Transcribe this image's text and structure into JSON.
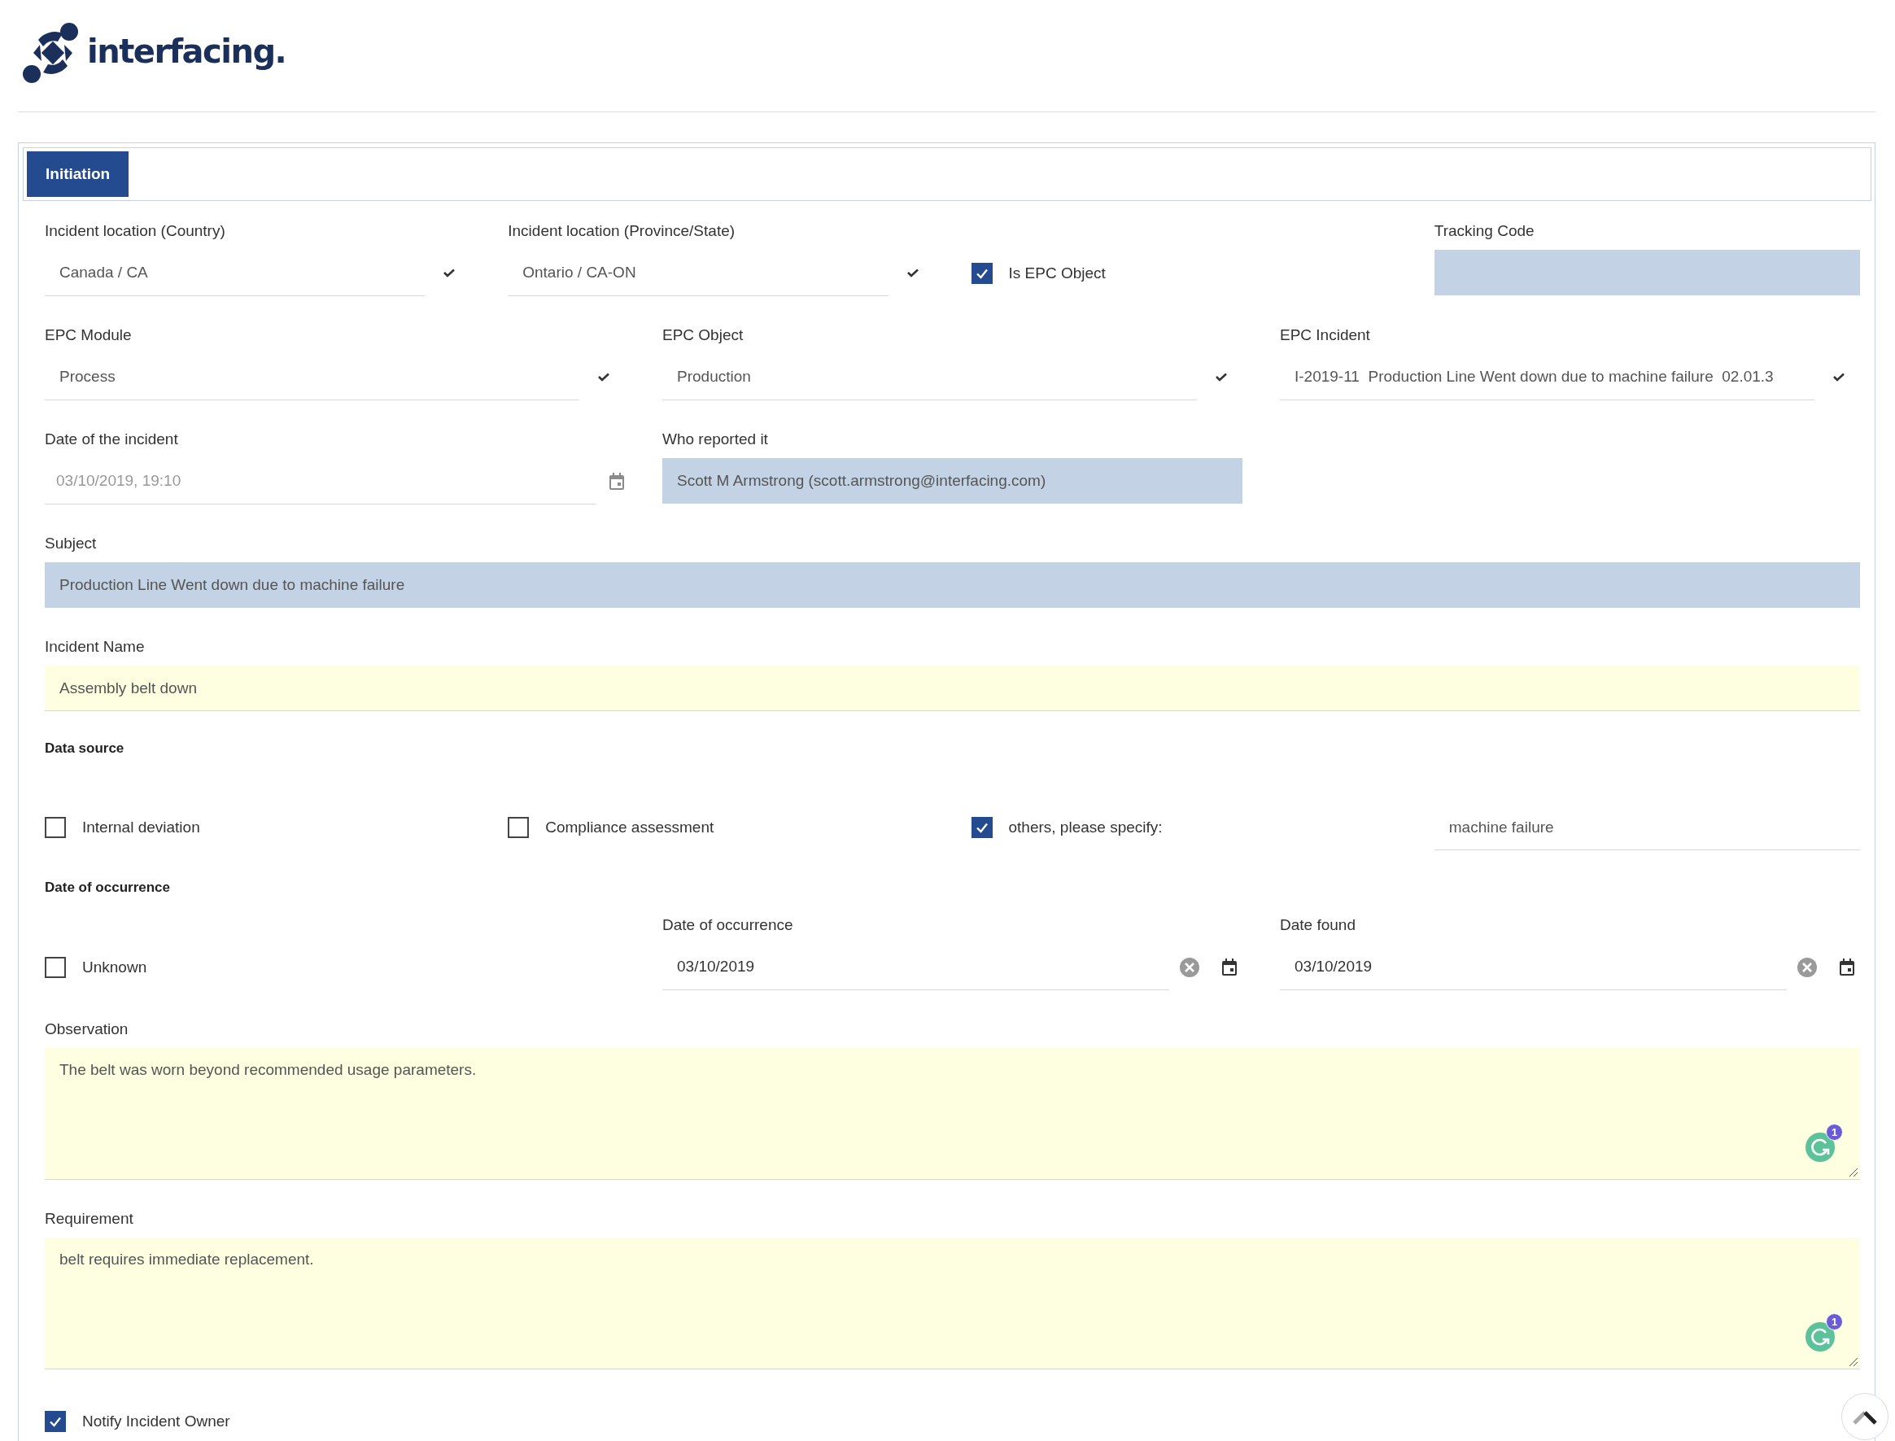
{
  "logo": {
    "text": "interfacing."
  },
  "tabs": [
    {
      "label": "Initiation",
      "selected": true
    }
  ],
  "rows": [
    {
      "fields": [
        {
          "kind": "select",
          "label": "Incident location (Country)",
          "value": "Canada / CA"
        },
        {
          "kind": "select",
          "label": "Incident location (Province/State)",
          "value": "Ontario / CA-ON"
        },
        {
          "kind": "checkbox",
          "label": "Is EPC Object",
          "checked": true
        },
        {
          "kind": "readonly",
          "label": "Tracking Code"
        }
      ]
    },
    {
      "fields": [
        {
          "kind": "select",
          "label": "EPC Module",
          "value": "Process"
        },
        {
          "kind": "select",
          "label": "EPC Object",
          "value": "Production"
        },
        {
          "kind": "select",
          "label": "EPC Incident",
          "value": "I-2019-11  Production Line Went down due to machine failure  02.01.3"
        }
      ]
    },
    {
      "fields": [
        {
          "kind": "datetime",
          "label": "Date of the incident",
          "value": "03/10/2019, 19:10",
          "disabled": true
        },
        {
          "kind": "readonly",
          "label": "Who reported it",
          "value": "Scott M Armstrong (scott.armstrong@interfacing.com)"
        }
      ]
    },
    {
      "fields": [
        {
          "kind": "readonly",
          "label": "Subject",
          "value": "Production Line Went down due to machine failure"
        }
      ]
    },
    {
      "fields": [
        {
          "kind": "input",
          "label": "Incident Name",
          "value": "Assembly belt down",
          "required": true
        }
      ]
    },
    {
      "fields": [
        {
          "kind": "heading",
          "label": "Data source"
        }
      ]
    },
    {
      "fields": [
        {
          "kind": "checkbox",
          "label": "Internal deviation",
          "checked": false
        },
        {
          "kind": "checkbox",
          "label": "Compliance assessment",
          "checked": false
        },
        {
          "kind": "checkbox",
          "label": "others, please specify:",
          "checked": true
        },
        {
          "kind": "input",
          "value": "machine failure",
          "required": false
        }
      ]
    },
    {
      "fields": [
        {
          "kind": "heading",
          "label": "Date of occurrence"
        }
      ]
    },
    {
      "fields": [
        {
          "kind": "checkbox",
          "label": "Unknown",
          "checked": false
        },
        {
          "kind": "datepicker",
          "label": "Date of occurrence",
          "value": "03/10/2019"
        },
        {
          "kind": "datepicker",
          "label": "Date found",
          "value": "03/10/2019"
        }
      ]
    },
    {
      "fields": [
        {
          "kind": "textarea",
          "label": "Observation",
          "value": "The belt was worn beyond recommended usage parameters.",
          "required": true,
          "badge": "1"
        }
      ]
    },
    {
      "fields": [
        {
          "kind": "textarea",
          "label": "Requirement",
          "value": "belt requires immediate replacement.",
          "required": true,
          "badge": "1"
        }
      ]
    },
    {
      "fields": [
        {
          "kind": "checkbox",
          "label": "Notify Incident Owner",
          "checked": true
        }
      ]
    }
  ]
}
